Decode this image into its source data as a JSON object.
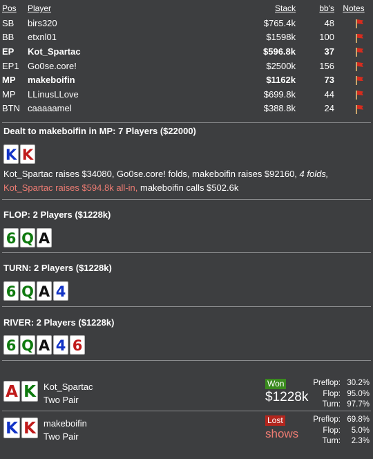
{
  "table_headers": {
    "pos": "Pos",
    "player": "Player",
    "stack": "Stack",
    "bbs": "bb's",
    "notes": "Notes"
  },
  "players": [
    {
      "pos": "SB",
      "name": "birs320",
      "stack": "$765.4k",
      "bbs": "48",
      "bold": false
    },
    {
      "pos": "BB",
      "name": "etxnl01",
      "stack": "$1598k",
      "bbs": "100",
      "bold": false
    },
    {
      "pos": "EP",
      "name": "Kot_Spartac",
      "stack": "$596.8k",
      "bbs": "37",
      "bold": true
    },
    {
      "pos": "EP1",
      "name": "Go0se.core!",
      "stack": "$2500k",
      "bbs": "156",
      "bold": false
    },
    {
      "pos": "MP",
      "name": "makeboifin",
      "stack": "$1162k",
      "bbs": "73",
      "bold": true
    },
    {
      "pos": "MP",
      "name": "LLinusLLove",
      "stack": "$699.8k",
      "bbs": "44",
      "bold": false
    },
    {
      "pos": "BTN",
      "name": "caaaaamel",
      "stack": "$388.8k",
      "bbs": "24",
      "bold": false
    }
  ],
  "preflop": {
    "title": "Dealt to makeboifin in MP: 7 Players ($22000)",
    "hole_cards": [
      {
        "rank": "K",
        "suit": "d"
      },
      {
        "rank": "K",
        "suit": "h"
      }
    ],
    "action_1": "Kot_Spartac raises $34080, Go0se.core! folds, makeboifin raises $92160, ",
    "action_1_italic": "4 folds,",
    "action_2_red": "Kot_Spartac raises $594.8k all-in,",
    "action_2": " makeboifin calls $502.6k"
  },
  "flop": {
    "title": "FLOP: 2 Players ($1228k)",
    "cards": [
      {
        "rank": "6",
        "suit": "c"
      },
      {
        "rank": "Q",
        "suit": "c"
      },
      {
        "rank": "A",
        "suit": "s"
      }
    ]
  },
  "turn": {
    "title": "TURN: 2 Players ($1228k)",
    "cards": [
      {
        "rank": "6",
        "suit": "c"
      },
      {
        "rank": "Q",
        "suit": "c"
      },
      {
        "rank": "A",
        "suit": "s"
      },
      {
        "rank": "4",
        "suit": "d"
      }
    ]
  },
  "river": {
    "title": "RIVER: 2 Players ($1228k)",
    "cards": [
      {
        "rank": "6",
        "suit": "c"
      },
      {
        "rank": "Q",
        "suit": "c"
      },
      {
        "rank": "A",
        "suit": "s"
      },
      {
        "rank": "4",
        "suit": "d"
      },
      {
        "rank": "6",
        "suit": "h"
      }
    ]
  },
  "showdown": [
    {
      "name": "Kot_Spartac",
      "hand": "Two Pair",
      "result": "Won",
      "amount": "$1228k",
      "cards": [
        {
          "rank": "A",
          "suit": "h"
        },
        {
          "rank": "K",
          "suit": "c"
        }
      ],
      "equity": [
        {
          "label": "Preflop:",
          "value": "30.2%"
        },
        {
          "label": "Flop:",
          "value": "95.0%"
        },
        {
          "label": "Turn:",
          "value": "97.7%"
        }
      ]
    },
    {
      "name": "makeboifin",
      "hand": "Two Pair",
      "result": "Lost",
      "amount": "shows",
      "cards": [
        {
          "rank": "K",
          "suit": "d"
        },
        {
          "rank": "K",
          "suit": "h"
        }
      ],
      "equity": [
        {
          "label": "Preflop:",
          "value": "69.8%"
        },
        {
          "label": "Flop:",
          "value": "5.0%"
        },
        {
          "label": "Turn:",
          "value": "2.3%"
        }
      ]
    }
  ],
  "colors": {
    "background": "#3d3e40",
    "club": "#0f7a0f",
    "spade": "#111111",
    "diamond": "#1233c6",
    "heart": "#c01a1a",
    "won": "#3a8a1e",
    "lost": "#b3261e",
    "highlight": "#ee7c73"
  },
  "icons": {
    "note_flag": "red-flag-icon"
  }
}
